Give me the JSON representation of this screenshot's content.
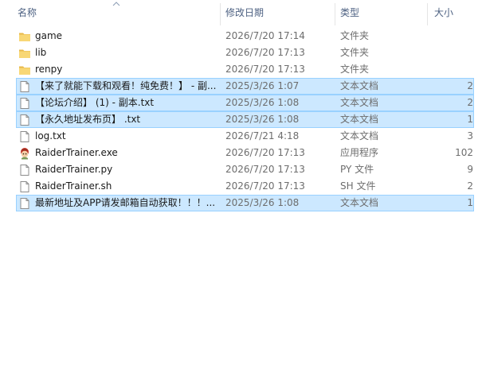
{
  "columns": {
    "name": "名称",
    "date": "修改日期",
    "type": "类型",
    "size": "大小"
  },
  "files": [
    {
      "name": "game",
      "date": "2026/7/20 17:14",
      "type": "文件夹",
      "size": "",
      "icon": "folder-icon",
      "selected": false
    },
    {
      "name": "lib",
      "date": "2026/7/20 17:13",
      "type": "文件夹",
      "size": "",
      "icon": "folder-icon",
      "selected": false
    },
    {
      "name": "renpy",
      "date": "2026/7/20 17:13",
      "type": "文件夹",
      "size": "",
      "icon": "folder-icon",
      "selected": false
    },
    {
      "name": "【来了就能下载和观看！纯免费！】 - 副...",
      "date": "2025/3/26 1:07",
      "type": "文本文档",
      "size": "2",
      "icon": "document-icon",
      "selected": true
    },
    {
      "name": "【论坛介绍】 (1) - 副本.txt",
      "date": "2025/3/26 1:08",
      "type": "文本文档",
      "size": "2",
      "icon": "document-icon",
      "selected": true
    },
    {
      "name": "【永久地址发布页】 .txt",
      "date": "2025/3/26 1:08",
      "type": "文本文档",
      "size": "1",
      "icon": "document-icon",
      "selected": true
    },
    {
      "name": "log.txt",
      "date": "2026/7/21 4:18",
      "type": "文本文档",
      "size": "3",
      "icon": "document-icon",
      "selected": false
    },
    {
      "name": "RaiderTrainer.exe",
      "date": "2026/7/20 17:13",
      "type": "应用程序",
      "size": "102",
      "icon": "application-icon",
      "selected": false
    },
    {
      "name": "RaiderTrainer.py",
      "date": "2026/7/20 17:13",
      "type": "PY 文件",
      "size": "9",
      "icon": "document-icon",
      "selected": false
    },
    {
      "name": "RaiderTrainer.sh",
      "date": "2026/7/20 17:13",
      "type": "SH 文件",
      "size": "2",
      "icon": "document-icon",
      "selected": false
    },
    {
      "name": "最新地址及APP请发邮箱自动获取！！！...",
      "date": "2025/3/26 1:08",
      "type": "文本文档",
      "size": "1",
      "icon": "document-icon",
      "selected": true
    }
  ],
  "colors": {
    "selection_fill": "#cce8ff",
    "selection_border": "#99d1ff",
    "header_text": "#4d6182",
    "folder": "#f8d775"
  }
}
